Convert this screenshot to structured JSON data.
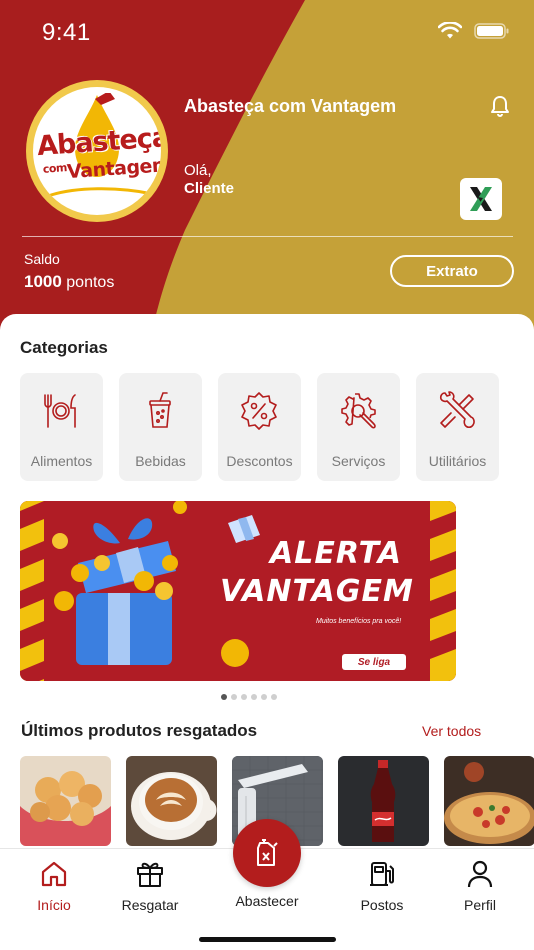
{
  "colors": {
    "brand_red": "#a81e1e",
    "brand_gold": "#c5a138",
    "accent": "#b31d1d"
  },
  "status_bar": {
    "time": "9:41"
  },
  "header": {
    "logo_line1": "Abasteça",
    "logo_small": "com",
    "logo_line2": "Vantagem",
    "app_title": "Abasteça com Vantagem",
    "greeting": "Olá,",
    "user_name": "Cliente",
    "balance_label": "Saldo",
    "balance_value": "1000",
    "balance_unit": "pontos",
    "statement_button": "Extrato"
  },
  "categories": {
    "title": "Categorias",
    "items": [
      {
        "label": "Alimentos",
        "icon": "utensils-icon"
      },
      {
        "label": "Bebidas",
        "icon": "drink-cup-icon"
      },
      {
        "label": "Descontos",
        "icon": "discount-badge-icon"
      },
      {
        "label": "Serviços",
        "icon": "gear-wrench-icon"
      },
      {
        "label": "Utilitários",
        "icon": "tools-icon"
      }
    ]
  },
  "banner": {
    "title_line1": "ALERTA",
    "title_line2": "VANTAGEM",
    "subtitle": "Muitos benefícios pra você!",
    "cta": "Se liga",
    "page_count": 6,
    "active_page": 1
  },
  "products": {
    "title": "Últimos produtos resgatados",
    "see_all": "Ver todos",
    "items": [
      {
        "name": "pão de queijo",
        "icon": "cheese-bread-image"
      },
      {
        "name": "café",
        "icon": "latte-image"
      },
      {
        "name": "chuveiro",
        "icon": "shower-image"
      },
      {
        "name": "refrigerante",
        "icon": "soda-bottle-image"
      },
      {
        "name": "pizza",
        "icon": "pizza-image"
      }
    ]
  },
  "bottom_nav": {
    "items": [
      {
        "label": "Início",
        "icon": "home-icon",
        "active": true
      },
      {
        "label": "Resgatar",
        "icon": "gift-icon",
        "active": false
      },
      {
        "label": "Abastecer",
        "icon": "fuel-can-icon",
        "active": false
      },
      {
        "label": "Postos",
        "icon": "gas-station-icon",
        "active": false
      },
      {
        "label": "Perfil",
        "icon": "user-icon",
        "active": false
      }
    ]
  }
}
